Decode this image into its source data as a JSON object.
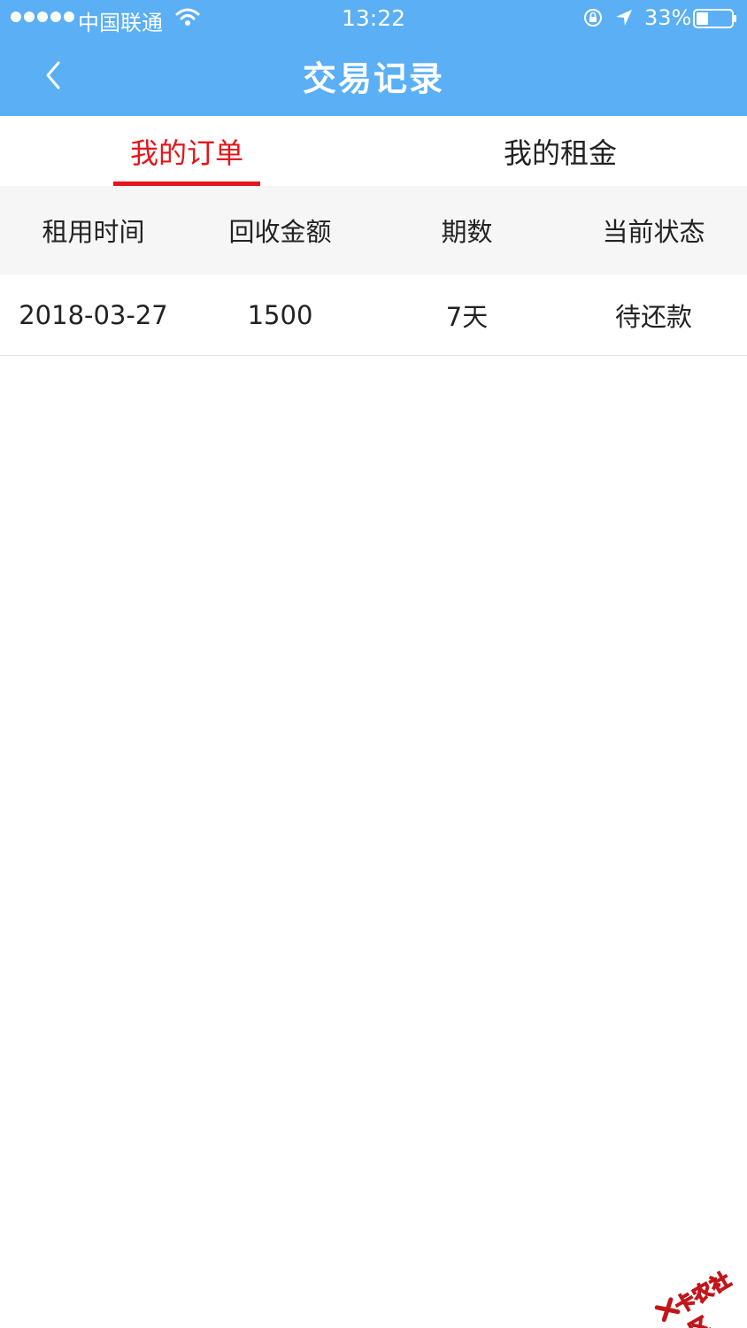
{
  "status_bar": {
    "carrier": "中国联通",
    "time": "13:22",
    "battery": "33%"
  },
  "nav": {
    "title": "交易记录"
  },
  "tabs": [
    {
      "label": "我的订单",
      "active": true
    },
    {
      "label": "我的租金",
      "active": false
    }
  ],
  "table": {
    "columns": [
      "租用时间",
      "回收金额",
      "期数",
      "当前状态"
    ],
    "rows": [
      [
        "2018-03-27",
        "1500",
        "7天",
        "待还款"
      ]
    ]
  },
  "watermark": {
    "text": "卡农社区"
  },
  "colors": {
    "header": "#5aaff5",
    "accent": "#e4151a"
  }
}
